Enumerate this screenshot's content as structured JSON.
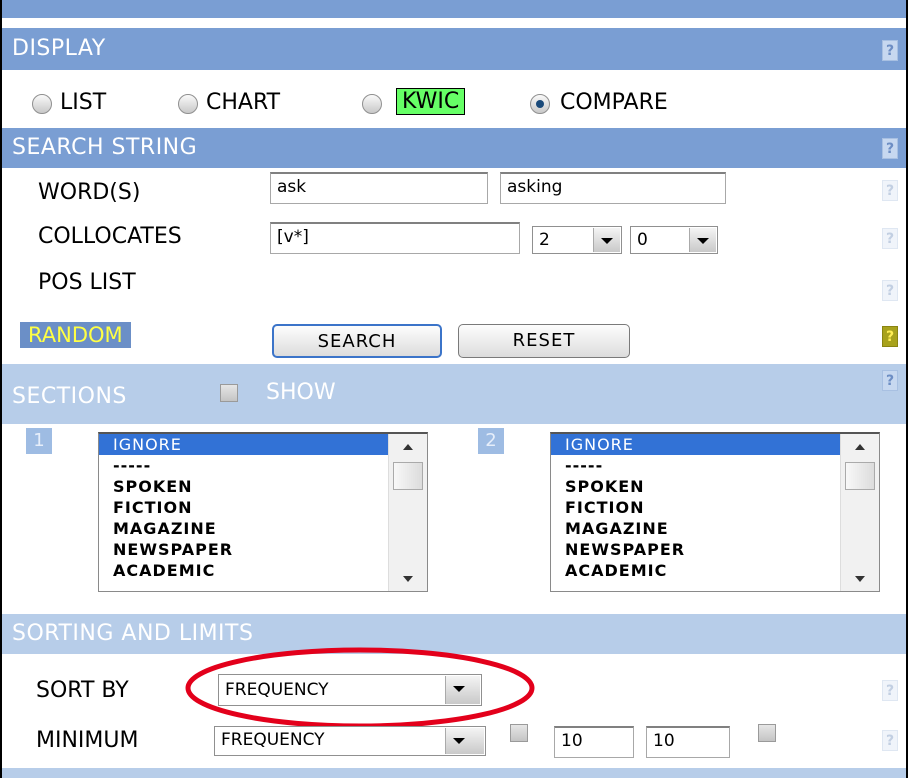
{
  "display": {
    "title": "DISPLAY",
    "help": "?",
    "options": [
      {
        "label": "LIST",
        "checked": false
      },
      {
        "label": "CHART",
        "checked": false
      },
      {
        "label": "KWIC",
        "checked": false,
        "highlight_color": "#66ff66"
      },
      {
        "label": "COMPARE",
        "checked": true
      }
    ]
  },
  "search_string": {
    "title": "SEARCH STRING",
    "help": "?",
    "words_label": "WORD(S)",
    "word1": "ask",
    "word2": "asking",
    "collocates_label": "COLLOCATES",
    "collocates_value": "[v*]",
    "span_left": "2",
    "span_right": "0",
    "pos_list_label": "POS LIST",
    "random_label": "RANDOM",
    "search_button": "SEARCH",
    "reset_button": "RESET"
  },
  "sections": {
    "title": "SECTIONS",
    "show_label": "SHOW",
    "list1_number": "1",
    "list2_number": "2",
    "items": [
      "IGNORE",
      "-----",
      "SPOKEN",
      "FICTION",
      "MAGAZINE",
      "NEWSPAPER",
      "ACADEMIC"
    ],
    "selected": "IGNORE"
  },
  "sorting": {
    "title": "SORTING AND LIMITS",
    "sort_by_label": "SORT BY",
    "sort_by_value": "FREQUENCY",
    "minimum_label": "MINIMUM",
    "minimum_value": "FREQUENCY",
    "min_value1": "10",
    "min_value2": "10",
    "annotation_color": "#e3001b"
  },
  "colors": {
    "header_bar": "#7a9ed3",
    "header_bar_light": "#b7cde9",
    "random_bg": "#6b8fc7",
    "random_text": "#ffff44"
  }
}
